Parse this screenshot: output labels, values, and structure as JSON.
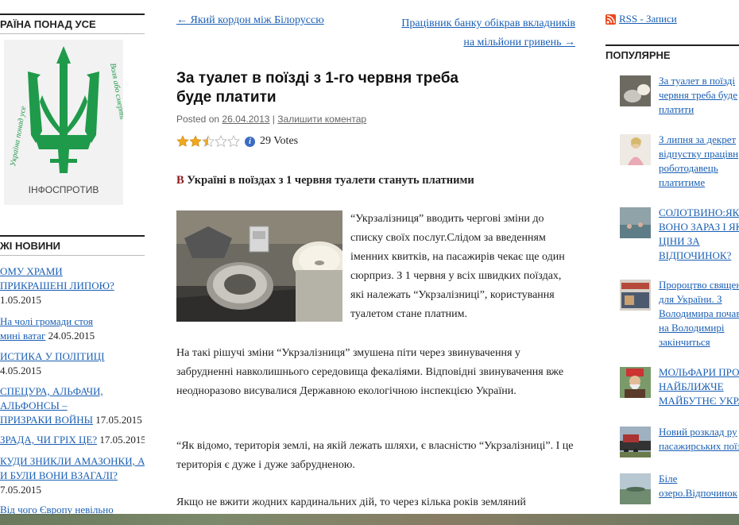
{
  "left_sidebar": {
    "section1_title": "РАЇНА ПОНАД УСЕ",
    "logo": {
      "caption": "ІНФОСПРОТИВ",
      "left_text": "Україна понад усе",
      "right_text": "Воля або смерть"
    },
    "section2_title": "ЖІ НОВИНИ",
    "news": [
      {
        "title_l1": "ОМУ ХРАМИ",
        "title_l2": "ПРИКРАШЕНІ ЛИПОЮ?",
        "date": "1.05.2015"
      },
      {
        "title_l1": "На чолі громади стоя",
        "title_l2": "мині ватаг",
        "date": "24.05.2015"
      },
      {
        "title_l1": "ИСТИКА У ПОЛІТИЦІ",
        "title_l2": "",
        "date": "4.05.2015"
      },
      {
        "title_l1": "СПЕЦУРА, АЛЬФАЧИ,",
        "title_l2": "АЛЬФОНСЫ –",
        "title_l3": "ПРИЗРАКИ ВОЙНЫ",
        "date": "17.05.2015"
      },
      {
        "title_l1": "ЗРАДА, ЧИ ГРІХ ЦЕ?",
        "title_l2": "",
        "date": "17.05.2015"
      },
      {
        "title_l1": "КУДИ ЗНИКЛИ АМАЗОНКИ, А",
        "title_l2": "И БУЛИ ВОНИ ВЗАГАЛІ?",
        "date": "7.05.2015"
      },
      {
        "title_l1": "Від чого Європу невільно",
        "title_l2": "",
        "date": ""
      }
    ]
  },
  "main": {
    "nav_prev": "← Який кордон між Білоруссю",
    "nav_next_l1": "Працівник банку обікрав вкладників",
    "nav_next_l2": "на мільйони гривень →",
    "title_l1": "За туалет в поїзді з 1-го червня треба",
    "title_l2": "буде платити",
    "meta_posted": "Posted on",
    "meta_date": "26.04.2013",
    "meta_sep": "|",
    "meta_comment": "Залишити коментар",
    "rating": {
      "value": 2.5,
      "max": 5,
      "votes_label": "29 Votes"
    },
    "lead_cap": "В",
    "lead_rest": " Україні в поїздах з 1 червня туалети стануть платними",
    "p1": "“Укрзалізниця” вводить чергові зміни до списку своїх послуг.Слідом за введенням іменних квитків, на пасажирів чекає ще один сюрприз. З 1 червня у всіх швидких поїздах, які належать “Укрзалізниці”, користування туалетом стане платним.",
    "p2": "На такі рішучі зміни “Укрзалізниця” змушена піти через звинувачення у забрудненні навколишнього середовища фекаліями. Відповідні звинувачення вже неодноразово висувалися Державною екологічною інспекцією України.",
    "p3": "“Як відомо, територія землі, на якій лежать шляхи, є власністю “Укрзалізниці”. І це територія є дуже і дуже забрудненою.",
    "p4": "Якщо не вжити жодних кардинальних дій, то через кілька років земляний"
  },
  "right_sidebar": {
    "rss_label": "RSS - Записи",
    "popular_title": "ПОПУЛЯРНЕ",
    "popular": [
      {
        "lines": [
          "За туалет в поїзді",
          "червня треба буде",
          "платити"
        ]
      },
      {
        "lines": [
          "З липня за декрет",
          "відпустку працівн",
          "роботодавець",
          "платитиме"
        ]
      },
      {
        "lines": [
          "СОЛОТВИНО:ЯК",
          "ВОНО ЗАРАЗ І ЯК",
          "ЦІНИ ЗА",
          "ВІДПОЧИНОК?"
        ]
      },
      {
        "lines": [
          "Пророцтво священ",
          "для України. З",
          "Володимира почав",
          "на Володимирі",
          "закінчиться"
        ]
      },
      {
        "lines": [
          "МОЛЬФАРИ ПРО",
          "НАЙБЛИЖЧЕ",
          "МАЙБУТНЄ УКРА"
        ]
      },
      {
        "lines": [
          "Новий розклад ру",
          "пасажирських поїз"
        ]
      },
      {
        "lines": [
          "Біле",
          "озеро.Відпочинок"
        ]
      }
    ]
  },
  "colors": {
    "link": "#1a5fb4",
    "logo_green": "#1f9a4a",
    "drop_cap": "#8b1a1a",
    "star": "#f0a81c"
  }
}
